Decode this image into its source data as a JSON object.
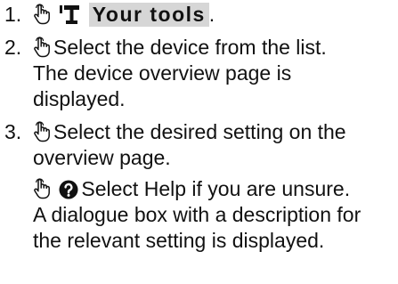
{
  "steps": [
    {
      "number": "1.",
      "icons": [
        "tap-hand-icon",
        "tools-icon"
      ],
      "label": "Your tools",
      "suffix": "."
    },
    {
      "number": "2.",
      "icons": [
        "tap-hand-icon"
      ],
      "action": "Select the device from the list.",
      "result": "The device overview page is displayed."
    },
    {
      "number": "3.",
      "icons": [
        "tap-hand-icon"
      ],
      "action": "Select the desired setting on the overview page.",
      "substep": {
        "icons": [
          "tap-hand-icon",
          "help-icon"
        ],
        "action": "Select Help if you are unsure.",
        "result": "A dialogue box with a description for the relevant setting is displayed."
      }
    }
  ]
}
